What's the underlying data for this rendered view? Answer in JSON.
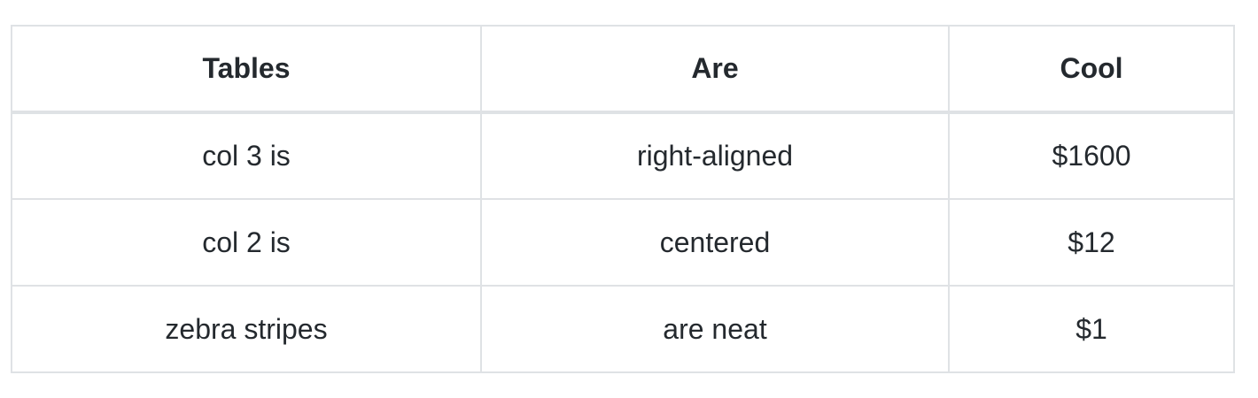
{
  "table": {
    "headers": [
      "Tables",
      "Are",
      "Cool"
    ],
    "rows": [
      [
        "col 3 is",
        "right-aligned",
        "$1600"
      ],
      [
        "col 2 is",
        "centered",
        "$12"
      ],
      [
        "zebra stripes",
        "are neat",
        "$1"
      ]
    ]
  },
  "colors": {
    "text": "#24292e",
    "border": "#dfe2e5",
    "background": "#ffffff"
  }
}
